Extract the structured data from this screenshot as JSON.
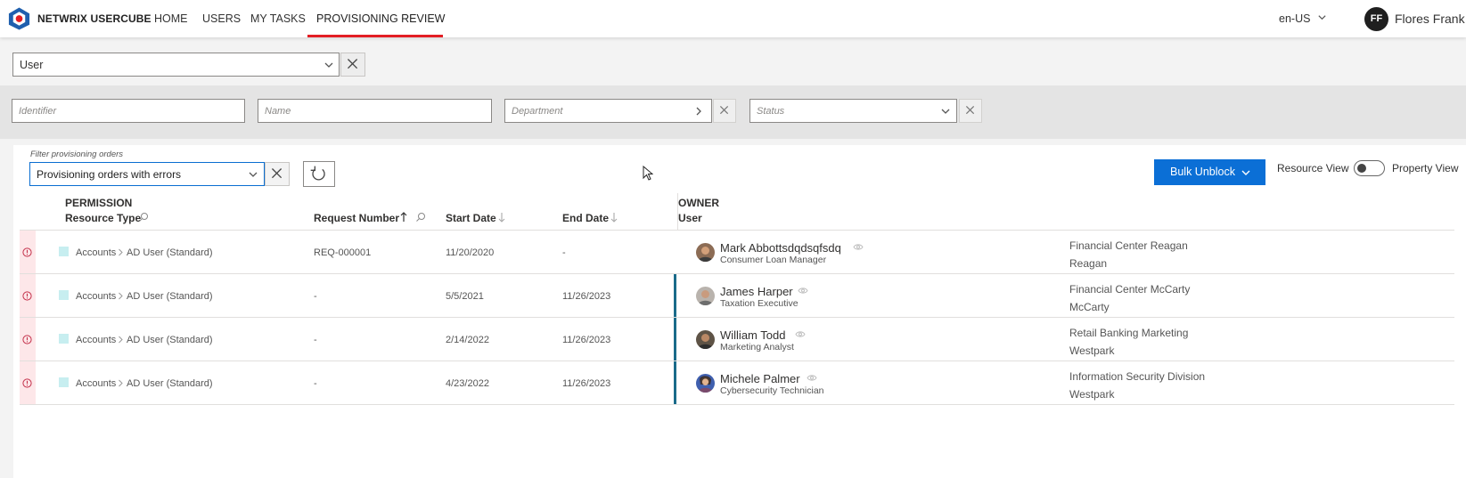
{
  "header": {
    "brand": "NETWRIX USERCUBE",
    "nav": [
      "HOME",
      "USERS",
      "MY TASKS",
      "PROVISIONING REVIEW"
    ],
    "active_nav": "PROVISIONING REVIEW",
    "locale": "en-US",
    "user_initials": "FF",
    "user_name": "Flores Frank",
    "accent_color": "#e31e24"
  },
  "entity_select": {
    "value": "User"
  },
  "filters": {
    "identifier_placeholder": "Identifier",
    "name_placeholder": "Name",
    "department_placeholder": "Department",
    "status_placeholder": "Status"
  },
  "toolbar": {
    "filter_label": "Filter provisioning orders",
    "filter_value": "Provisioning orders with errors",
    "bulk_label": "Bulk Unblock",
    "view_left": "Resource View",
    "view_right": "Property View",
    "bulk_color": "#0b6fd6"
  },
  "table": {
    "headers": {
      "permission": "PERMISSION",
      "resource_type": "Resource Type",
      "request_number": "Request Number",
      "start_date": "Start Date",
      "end_date": "End Date",
      "owner": "OWNER",
      "owner_user": "User"
    },
    "rows": [
      {
        "category": "Accounts",
        "resource": "AD User (Standard)",
        "request": "REQ-000001",
        "start": "11/20/2020",
        "end": "-",
        "owner_name": "Mark Abbottsdqdsqfsdq",
        "owner_title": "Consumer Loan Manager",
        "dept1": "Financial Center Reagan",
        "dept2": "Reagan"
      },
      {
        "category": "Accounts",
        "resource": "AD User (Standard)",
        "request": "-",
        "start": "5/5/2021",
        "end": "11/26/2023",
        "owner_name": "James Harper",
        "owner_title": "Taxation Executive",
        "dept1": "Financial Center McCarty",
        "dept2": "McCarty"
      },
      {
        "category": "Accounts",
        "resource": "AD User (Standard)",
        "request": "-",
        "start": "2/14/2022",
        "end": "11/26/2023",
        "owner_name": "William Todd",
        "owner_title": "Marketing Analyst",
        "dept1": "Retail Banking Marketing",
        "dept2": "Westpark"
      },
      {
        "category": "Accounts",
        "resource": "AD User (Standard)",
        "request": "-",
        "start": "4/23/2022",
        "end": "11/26/2023",
        "owner_name": "Michele Palmer",
        "owner_title": "Cybersecurity Technician",
        "dept1": "Information Security Division",
        "dept2": "Westpark"
      }
    ]
  }
}
